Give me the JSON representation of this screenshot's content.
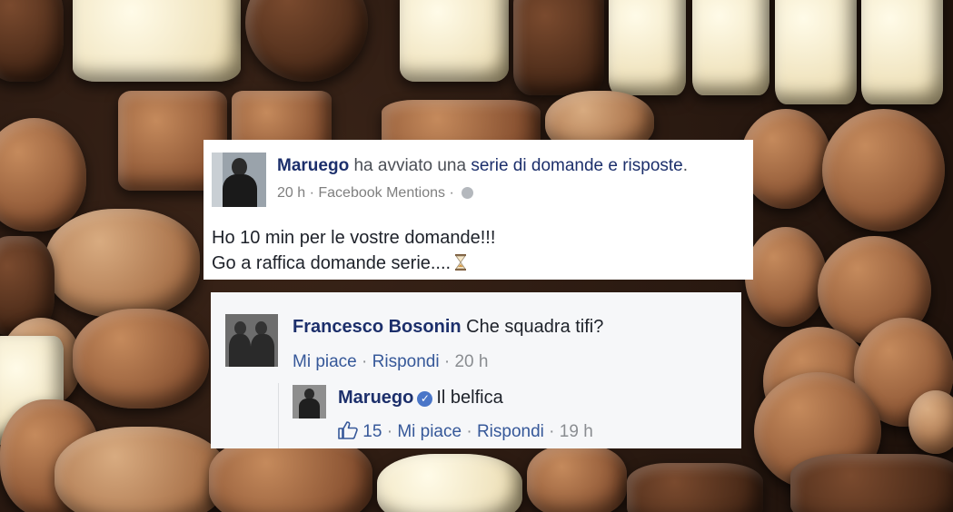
{
  "post": {
    "author": "Maruego",
    "action_text": "ha avviato una",
    "action_link": "serie di domande e risposte",
    "action_end": ".",
    "time": "20 h",
    "separator": "·",
    "source": "Facebook Mentions",
    "body_line1": "Ho 10 min per le vostre domande!!!",
    "body_line2": "Go a raffica domande serie...."
  },
  "comments": [
    {
      "author": "Francesco Bosonin",
      "text": "Che squadra tifi?",
      "like_label": "Mi piace",
      "reply_label": "Rispondi",
      "time": "20 h"
    }
  ],
  "reply": {
    "author": "Maruego",
    "text": "Il belfica",
    "like_count": "15",
    "like_label": "Mi piace",
    "reply_label": "Rispondi",
    "time": "19 h"
  },
  "colors": {
    "name": "#1c2f6b",
    "link": "#365899",
    "verified": "#4a76c8"
  },
  "icons": {
    "globe": "globe-icon",
    "hourglass": "hourglass-icon",
    "verified": "verified-badge-icon",
    "like": "thumbs-up-icon"
  }
}
